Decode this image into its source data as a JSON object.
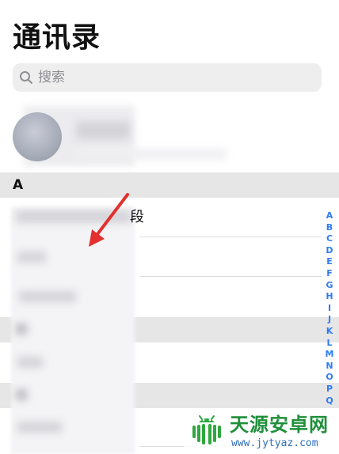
{
  "header": {
    "title": "通讯录"
  },
  "search": {
    "placeholder": "搜索",
    "icon": "search-icon"
  },
  "my_card": {
    "icon": "avatar"
  },
  "sections": [
    {
      "letter": "A",
      "visible_text_fragments": [
        "段"
      ]
    }
  ],
  "index_bar": {
    "letters": [
      "A",
      "B",
      "C",
      "D",
      "E",
      "F",
      "G",
      "H",
      "I",
      "J",
      "K",
      "L",
      "M",
      "N",
      "O",
      "P",
      "Q"
    ]
  },
  "annotation": {
    "icon": "red-arrow-icon",
    "color": "#e3302f"
  },
  "watermark": {
    "title": "天源安卓网",
    "url": "www.jytyaz.com",
    "icon": "android-logo-icon"
  },
  "colors": {
    "index_blue": "#2f7cf6",
    "section_bg": "#e6e6e6",
    "search_bg": "#eeeeef"
  }
}
